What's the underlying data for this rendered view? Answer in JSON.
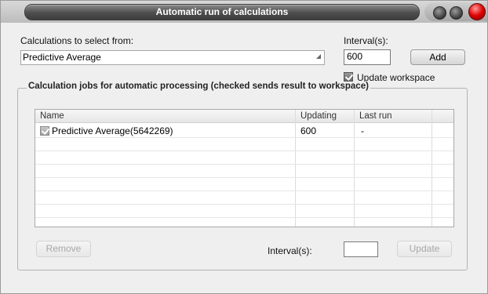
{
  "window": {
    "title": "Automatic run of calculations"
  },
  "selection": {
    "calc_label": "Calculations to select from:",
    "calc_value": "Predictive Average",
    "interval_label": "Interval(s):",
    "interval_value": "600",
    "add_label": "Add",
    "update_workspace_label": "Update workspace",
    "update_workspace_checked": true
  },
  "jobs": {
    "group_title": "Calculation jobs for automatic processing (checked sends result to workspace)",
    "columns": [
      "Name",
      "Updating",
      "Last run"
    ],
    "rows": [
      {
        "name": "Predictive Average(5642269)",
        "updating": "600",
        "last_run": "-",
        "checked": true
      }
    ],
    "remove_label": "Remove",
    "interval_label": "Interval(s):",
    "interval_value": "",
    "update_label": "Update"
  },
  "icons": {
    "window_controls": [
      "minimize-icon",
      "maximize-icon",
      "close-icon"
    ],
    "combo": "dropdown-arrow-icon"
  },
  "colors": {
    "title_bar": "#4e4e4e",
    "close_button": "#e00000"
  }
}
